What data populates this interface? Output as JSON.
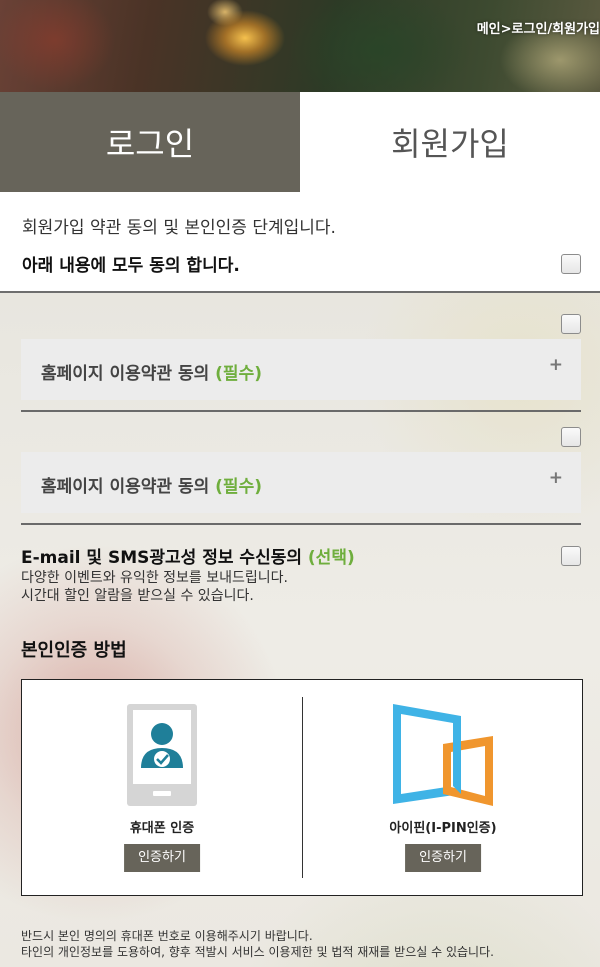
{
  "header": {
    "breadcrumb": "메인>로그인/회원가입"
  },
  "tabs": [
    {
      "label": "로그인"
    },
    {
      "label": "회원가입"
    }
  ],
  "intro": {
    "text": "회원가입 약관 동의 및 본인인증 단계입니다.",
    "agree_all_label": "아래 내용에 모두 동의 합니다."
  },
  "terms": [
    {
      "title": "홈페이지 이용약관 동의 ",
      "tag": "(필수)",
      "expand_icon": "+"
    },
    {
      "title": "홈페이지 이용약관 동의 ",
      "tag": "(필수)",
      "expand_icon": "+"
    }
  ],
  "marketing": {
    "title": "E-mail 및 SMS광고성 정보 수신동의 ",
    "tag": "(선택)",
    "desc_line1": "다양한 이벤트와 유익한 정보를 보내드립니다.",
    "desc_line2": "시간대 할인 알람을 받으실 수 있습니다."
  },
  "auth": {
    "title": "본인인증 방법",
    "methods": [
      {
        "label": "휴대폰 인증",
        "button": "인증하기",
        "icon": "phone-icon"
      },
      {
        "label": "아이핀(I-PIN인증)",
        "button": "인증하기",
        "icon": "ipin-icon"
      }
    ]
  },
  "notice": {
    "line1": "반드시 본인 명의의 휴대폰 번호로 이용해주시기 바랍니다.",
    "line2": "타인의 개인정보를 도용하여, 향후 적발시 서비스 이용제한 및 법적 재재를 받으실 수 있습니다."
  },
  "colors": {
    "tab_active_bg": "#67645a",
    "required_green": "#6fae3d",
    "button_bg": "#67645a"
  }
}
